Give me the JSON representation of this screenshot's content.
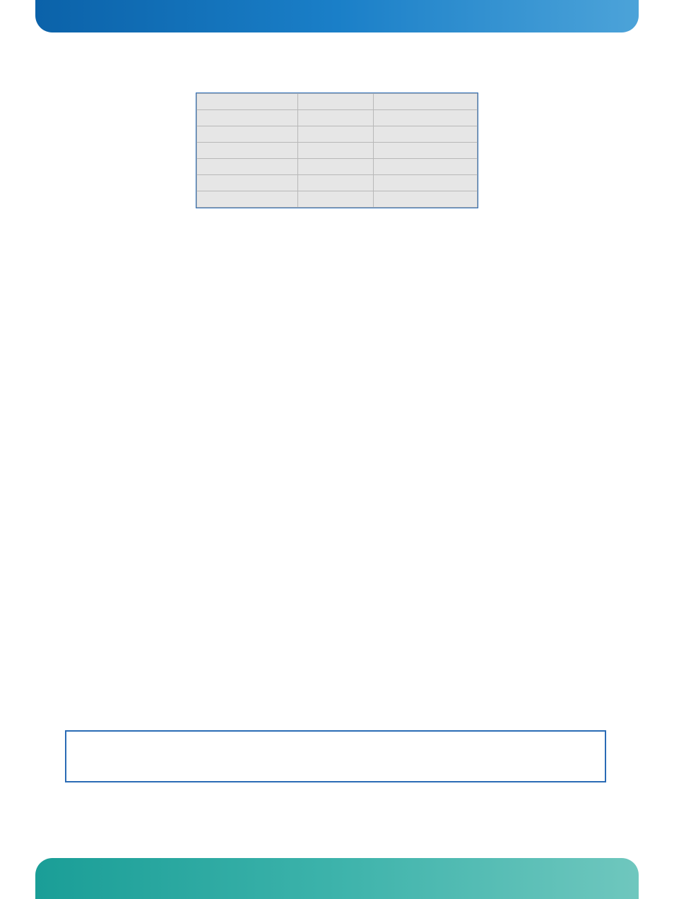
{
  "top_banner": {
    "color_start": "#0b62a9",
    "color_end": "#4ca3d9"
  },
  "table": {
    "rows": [
      {
        "col1": "",
        "col2": "",
        "col3": ""
      },
      {
        "col1": "",
        "col2": "",
        "col3": ""
      },
      {
        "col1": "",
        "col2": "",
        "col3": ""
      },
      {
        "col1": "",
        "col2": "",
        "col3": ""
      },
      {
        "col1": "",
        "col2": "",
        "col3": ""
      },
      {
        "col1": "",
        "col2": "",
        "col3": ""
      },
      {
        "col1": "",
        "col2": "",
        "col3": ""
      }
    ]
  },
  "outlined_box": {
    "content": ""
  },
  "bottom_banner": {
    "color_start": "#1a9e97",
    "color_end": "#6fc7be"
  }
}
